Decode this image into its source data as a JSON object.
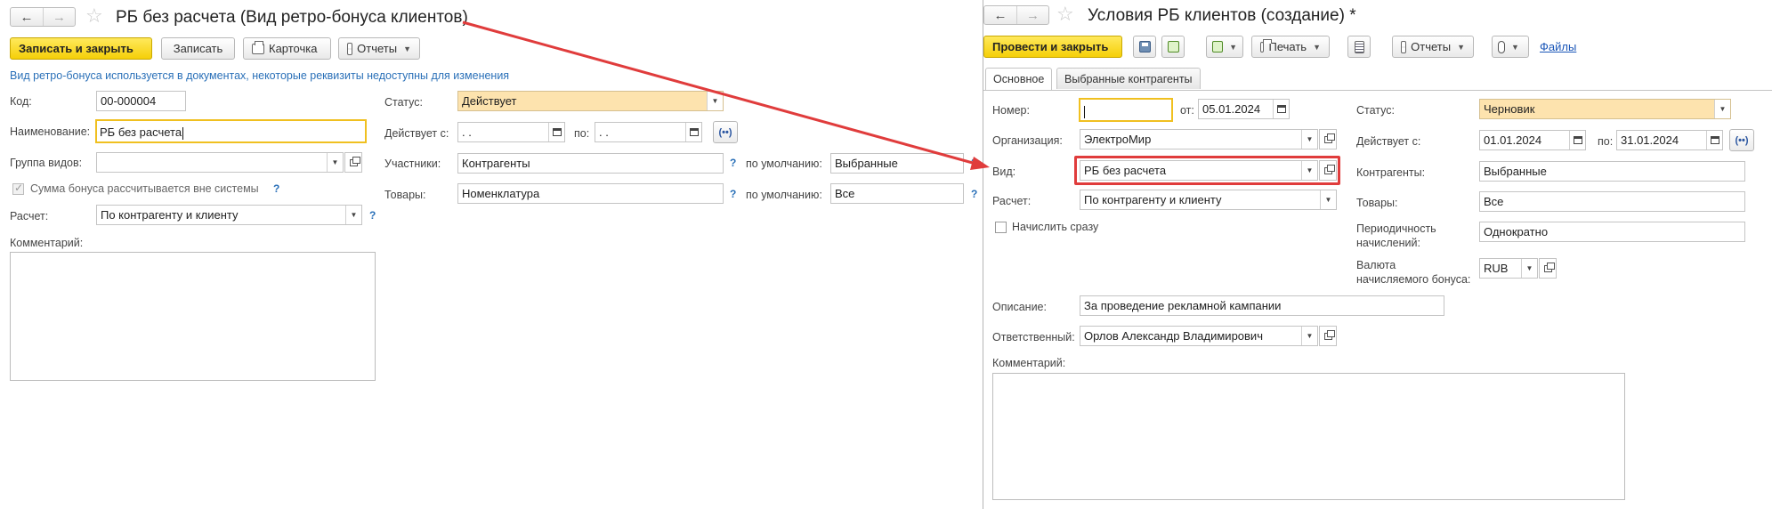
{
  "left": {
    "title": "РБ без расчета (Вид ретро-бонуса клиентов)",
    "toolbar": {
      "save_close": "Записать и закрыть",
      "save": "Записать",
      "card": "Карточка",
      "reports": "Отчеты"
    },
    "info": "Вид ретро-бонуса используется в документах, некоторые реквизиты недоступны для изменения",
    "labels": {
      "code": "Код:",
      "name": "Наименование:",
      "group": "Группа видов:",
      "bonus_outside": "Сумма бонуса рассчитывается вне системы",
      "calc": "Расчет:",
      "comment": "Комментарий:",
      "status": "Статус:",
      "valid_from": "Действует с:",
      "to": "по:",
      "participants": "Участники:",
      "goods": "Товары:",
      "default": "по умолчанию:"
    },
    "values": {
      "code": "00-000004",
      "name": "РБ без расчета",
      "group": "",
      "calc": "По контрагенту и клиенту",
      "status": "Действует",
      "valid_from": "  .  .",
      "valid_to": "  .  .",
      "participants": "Контрагенты",
      "participants_default": "Выбранные",
      "goods": "Номенклатура",
      "goods_default": "Все"
    },
    "help": "?"
  },
  "right": {
    "title": "Условия РБ клиентов (создание) *",
    "toolbar": {
      "post_close": "Провести и закрыть",
      "print": "Печать",
      "reports": "Отчеты",
      "files": "Файлы"
    },
    "tabs": [
      "Основное",
      "Выбранные контрагенты"
    ],
    "labels": {
      "number": "Номер:",
      "from": "от:",
      "org": "Организация:",
      "kind": "Вид:",
      "calc": "Расчет:",
      "accrue_now": "Начислить сразу",
      "description": "Описание:",
      "responsible": "Ответственный:",
      "comment": "Комментарий:",
      "status": "Статус:",
      "valid_from": "Действует с:",
      "to": "по:",
      "counterparties": "Контрагенты:",
      "goods": "Товары:",
      "periodicity_1": "Периодичность",
      "periodicity_2": "начислений:",
      "currency_1": "Валюта",
      "currency_2": "начисляемого бонуса:"
    },
    "values": {
      "number": "",
      "date": "05.01.2024",
      "org": "ЭлектроМир",
      "kind": "РБ без расчета",
      "calc": "По контрагенту и клиенту",
      "description": "За проведение рекламной кампании",
      "responsible": "Орлов Александр Владимирович",
      "status": "Черновик",
      "valid_from": "01.01.2024",
      "valid_to": "31.01.2024",
      "counterparties": "Выбранные",
      "goods": "Все",
      "periodicity": "Однократно",
      "currency": "RUB"
    }
  },
  "icons": {
    "back": "←",
    "forward": "→",
    "favorite": "☆",
    "dropdown": "▼",
    "period": "(••)"
  },
  "colors": {
    "primary_button": "#f5cf08",
    "status_field": "#fde3ae",
    "focus_border": "#f0c020",
    "info_text": "#2a70b8",
    "callout": "#e03c3c"
  }
}
